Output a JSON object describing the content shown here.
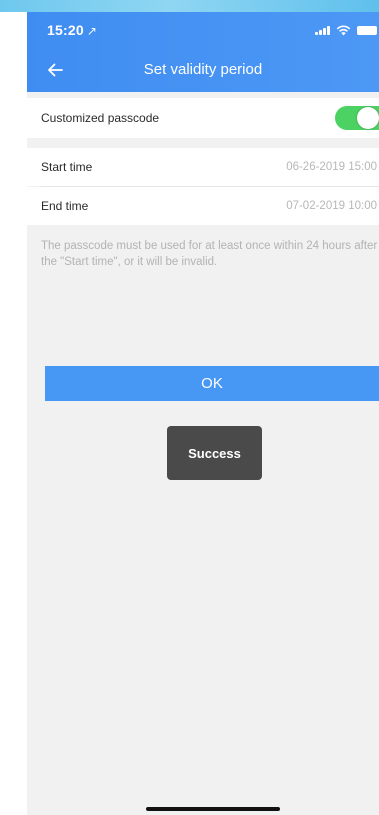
{
  "status_bar": {
    "time": "15:20",
    "location_arrow": "↗"
  },
  "header": {
    "title": "Set validity period",
    "back_icon": "arrow-left-icon"
  },
  "settings": {
    "customized_passcode": {
      "label": "Customized passcode",
      "enabled": true
    },
    "start_time": {
      "label": "Start time",
      "value": "06-26-2019 15:00"
    },
    "end_time": {
      "label": "End time",
      "value": "07-02-2019 10:00"
    }
  },
  "note": "The passcode must be used for at least once within 24 hours after the \"Start time\", or it will be invalid.",
  "ok_button": {
    "label": "OK"
  },
  "toast": {
    "text": "Success"
  },
  "colors": {
    "header": "#4090f3",
    "toggle_on": "#4cd163",
    "button": "#4797f5",
    "toast": "#4a4a4a"
  }
}
